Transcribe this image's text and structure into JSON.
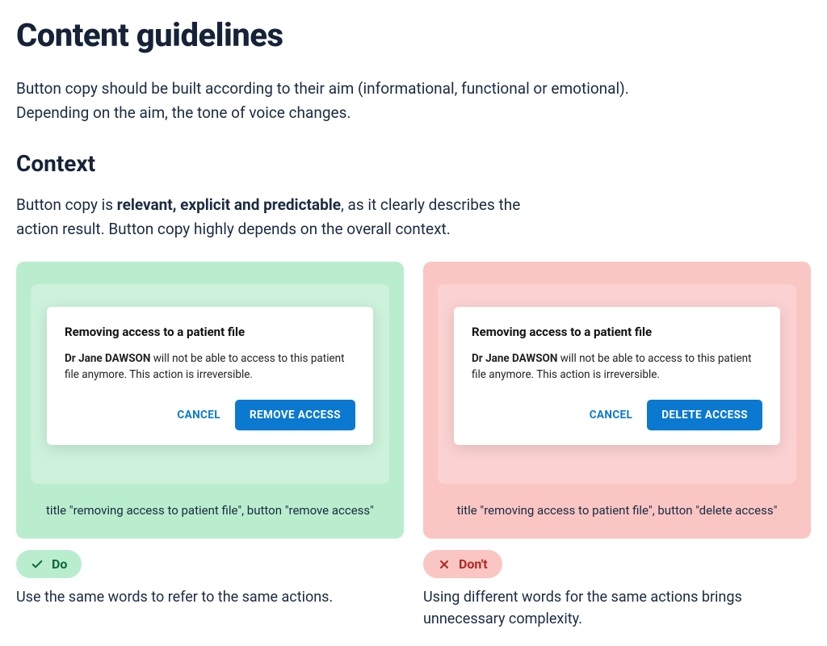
{
  "page": {
    "title": "Content guidelines",
    "intro": "Button copy should be built according to their aim (informational, functional or emotional). Depending on the aim, the tone of voice changes.",
    "context_heading": "Context",
    "context_para_pre": "Button copy is ",
    "context_para_bold": "relevant, explicit and predictable",
    "context_para_post": ", as it clearly describes the action result. Button copy highly depends on the overall context."
  },
  "dialog_common": {
    "title": "Removing access to a patient file",
    "body_bold": "Dr Jane DAWSON",
    "body_rest": " will not be able to access to this patient file anymore. This action is irreversible.",
    "cancel_label": "CANCEL"
  },
  "do_example": {
    "primary_label": "REMOVE ACCESS",
    "caption": "title \"removing access to patient file\", button \"remove access\"",
    "badge_label": "Do",
    "guidance": "Use the same words to refer to the same actions."
  },
  "dont_example": {
    "primary_label": "DELETE ACCESS",
    "caption": "title \"removing access to patient file\", button \"delete access\"",
    "badge_label": "Don't",
    "guidance": "Using different words for the same actions brings unnecessary complexity."
  }
}
